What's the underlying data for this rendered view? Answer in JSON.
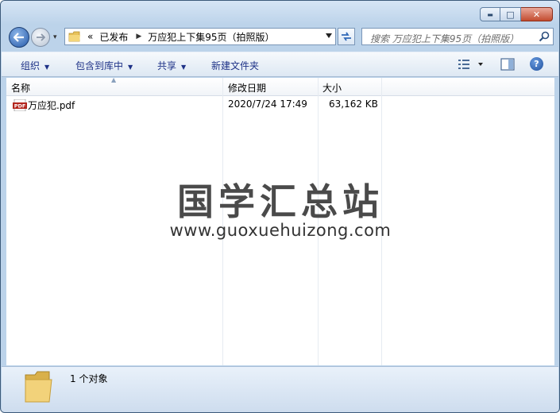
{
  "window": {
    "minimize_glyph": "▬",
    "maximize_glyph": "□",
    "close_glyph": "✕"
  },
  "nav": {
    "history_glyph": "▾",
    "breadcrumb_prefix": "«",
    "breadcrumb": [
      "已发布",
      "万应犯上下集95页（拍照版）"
    ],
    "search_placeholder": "搜索 万应犯上下集95页（拍照版）"
  },
  "toolbar": {
    "organize": "组织",
    "include_in_library": "包含到库中",
    "share": "共享",
    "new_folder": "新建文件夹",
    "help": "?"
  },
  "columns": {
    "name": "名称",
    "modified": "修改日期",
    "size": "大小"
  },
  "files": [
    {
      "name": "万应犯.pdf",
      "modified": "2020/7/24 17:49",
      "size": "63,162 KB",
      "icon": "pdf-icon"
    }
  ],
  "watermark": {
    "title": "国学汇总站",
    "url": "www.guoxuehuizong.com"
  },
  "status": {
    "count": "1 个对象"
  },
  "colors": {
    "accent": "#1e3287",
    "chrome": "#bcd3ea",
    "close": "#c34b2f"
  }
}
